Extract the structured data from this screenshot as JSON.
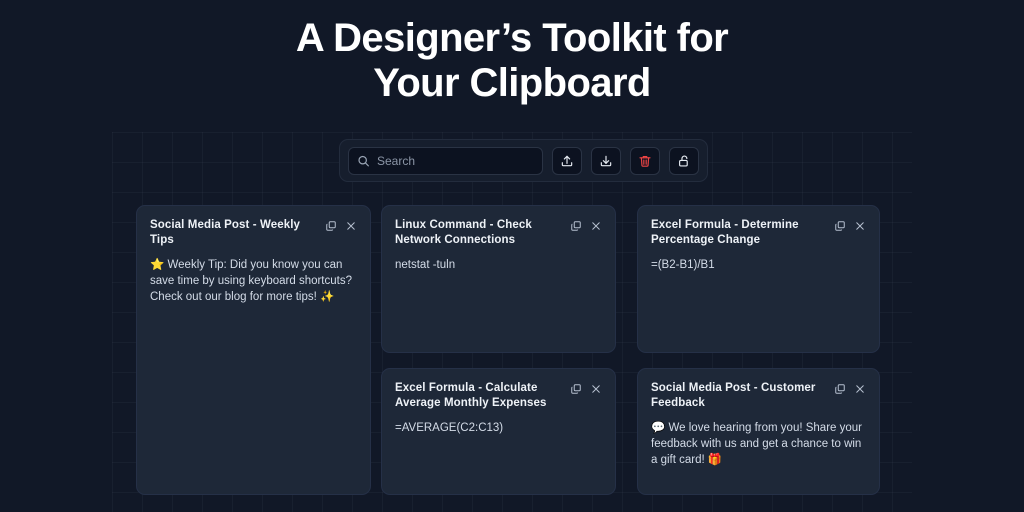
{
  "page": {
    "title": "A Designer’s Toolkit for\nYour Clipboard",
    "background_color": "#111827",
    "card_color": "#1e2838",
    "accent_danger_color": "#ef4444"
  },
  "toolbar": {
    "search": {
      "placeholder": "Search",
      "value": "",
      "icon": "search-icon"
    },
    "buttons": [
      {
        "name": "upload-button",
        "icon": "upload-icon",
        "label": "Upload"
      },
      {
        "name": "download-button",
        "icon": "download-icon",
        "label": "Download"
      },
      {
        "name": "delete-button",
        "icon": "trash-icon",
        "label": "Delete",
        "color": "#ef4444"
      },
      {
        "name": "lock-button",
        "icon": "unlock-icon",
        "label": "Unlock"
      }
    ]
  },
  "card_actions": {
    "copy_icon": "copy-icon",
    "close_icon": "close-icon"
  },
  "cards": [
    {
      "id": "social-weekly-tips",
      "title": "Social Media Post - Weekly Tips",
      "body": "⭐ Weekly Tip: Did you know you can save time by using keyboard shortcuts? Check out our blog for more tips! ✨",
      "column": 1
    },
    {
      "id": "linux-netstat",
      "title": "Linux Command - Check Network Connections",
      "body": "netstat -tuln",
      "column": 2
    },
    {
      "id": "excel-percentage-change",
      "title": "Excel Formula - Determine Percentage Change",
      "body": "=(B2-B1)/B1",
      "column": 3
    },
    {
      "id": "excel-average-expenses",
      "title": "Excel Formula - Calculate Average Monthly Expenses",
      "body": "=AVERAGE(C2:C13)",
      "column": 2
    },
    {
      "id": "social-customer-feedback",
      "title": "Social Media Post - Customer Feedback",
      "body": "💬 We love hearing from you! Share your feedback with us and get a chance to win a gift card! 🎁",
      "column": 3
    }
  ]
}
